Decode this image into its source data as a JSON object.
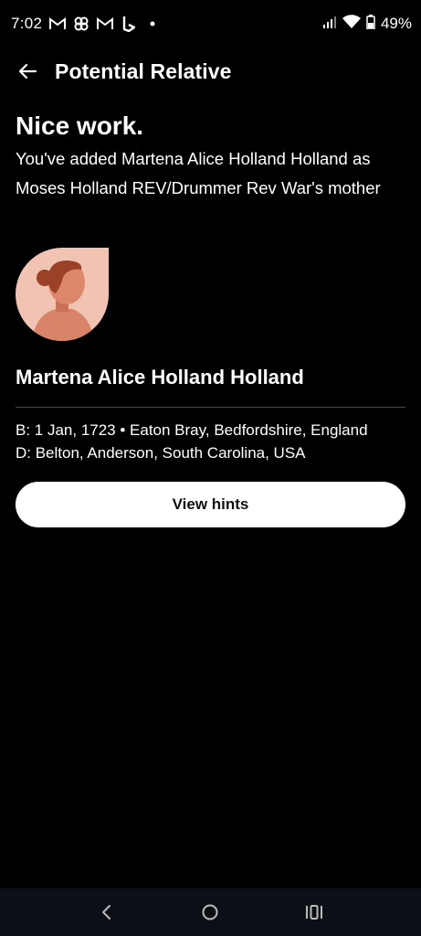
{
  "status_bar": {
    "time": "7:02",
    "notification_icons": [
      "gmail-icon",
      "pinwheel-icon",
      "gmail-icon",
      "bing-icon",
      "dot-icon"
    ],
    "battery": "49%"
  },
  "app_bar": {
    "title": "Potential Relative"
  },
  "confirmation": {
    "headline": "Nice work.",
    "message": "You've added Martena Alice Holland Holland as Moses Holland REV/Drummer Rev War's mother"
  },
  "person": {
    "name": "Martena Alice Holland Holland",
    "birth": "B: 1 Jan, 1723 • Eaton Bray, Bedfordshire, England",
    "death": "D: Belton, Anderson, South Carolina, USA",
    "avatar_icon": "female-avatar-icon"
  },
  "actions": {
    "view_hints_label": "View hints"
  },
  "colors": {
    "background": "#000000",
    "avatar_bg": "#f0c3b2",
    "avatar_skin": "#dc8769",
    "avatar_hair": "#9b4127",
    "button_bg": "#ffffff"
  }
}
